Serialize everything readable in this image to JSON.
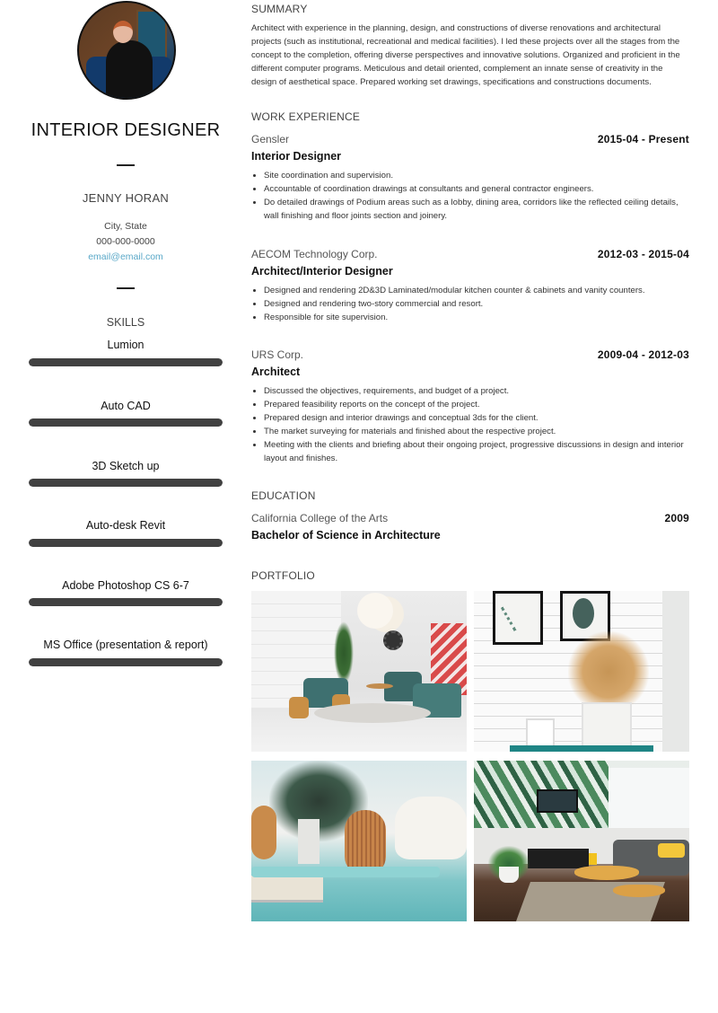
{
  "profile": {
    "job_title": "INTERIOR DESIGNER",
    "name": "JENNY HORAN",
    "city": "City, State",
    "phone": "000-000-0000",
    "email": "email@email.com"
  },
  "skills": {
    "heading": "SKILLS",
    "items": [
      {
        "label": "Lumion",
        "level": 1.0
      },
      {
        "label": "Auto CAD",
        "level": 1.0
      },
      {
        "label": "3D Sketch up",
        "level": 1.0
      },
      {
        "label": "Auto-desk Revit",
        "level": 1.0
      },
      {
        "label": "Adobe Photoshop CS 6-7",
        "level": 1.0
      },
      {
        "label": "MS Office (presentation & report)",
        "level": 1.0
      }
    ]
  },
  "summary": {
    "heading": "SUMMARY",
    "text": "Architect with experience in the planning, design, and constructions of diverse renovations and architectural projects (such as institutional, recreational and medical facilities). I led these projects over all the stages from the concept to the completion, offering diverse perspectives and innovative solutions. Organized and proficient in the different computer programs. Meticulous and detail oriented, complement an innate sense of creativity in the design of aesthetical space. Prepared working set drawings, specifications and constructions documents."
  },
  "work": {
    "heading": "WORK EXPERIENCE",
    "jobs": [
      {
        "company": "Gensler",
        "dates": "2015-04 - Present",
        "role": "Interior Designer",
        "bullets": [
          "Site coordination and supervision.",
          "Accountable of coordination drawings at consultants and general contractor engineers.",
          "Do detailed drawings of Podium areas such as a lobby, dining area, corridors like the reflected ceiling details, wall finishing and floor joints section and joinery."
        ]
      },
      {
        "company": "AECOM Technology Corp.",
        "dates": "2012-03 - 2015-04",
        "role": "Architect/Interior Designer",
        "bullets": [
          "Designed and rendering 2D&3D Laminated/modular kitchen counter & cabinets and vanity counters.",
          "Designed and rendering  two-story commercial and resort.",
          "Responsible for site supervision."
        ]
      },
      {
        "company": "URS Corp.",
        "dates": "2009-04 - 2012-03",
        "role": "Architect",
        "bullets": [
          "Discussed the objectives, requirements, and budget of a project.",
          "Prepared feasibility reports on the concept of the project.",
          "Prepared design and interior drawings and conceptual 3ds for the client.",
          "The market surveying for materials and finished about the respective project.",
          "Meeting with the clients and briefing about their ongoing project, progressive discussions in design and interior layout and finishes."
        ]
      }
    ]
  },
  "education": {
    "heading": "EDUCATION",
    "school": "California College of the Arts",
    "year": "2009",
    "degree": "Bachelor of Science in Architecture"
  },
  "portfolio": {
    "heading": "PORTFOLIO",
    "images": [
      {
        "subject": "lounge-with-teal-armchairs"
      },
      {
        "subject": "dried-pampas-grass-vase-brick-wall"
      },
      {
        "subject": "rattan-lantern-turquoise-console"
      },
      {
        "subject": "tropical-wallpaper-living-room"
      }
    ]
  },
  "colors": {
    "accent_email": "#5aa8c8",
    "skill_bar": "#414141",
    "heading_text": "#444444"
  }
}
